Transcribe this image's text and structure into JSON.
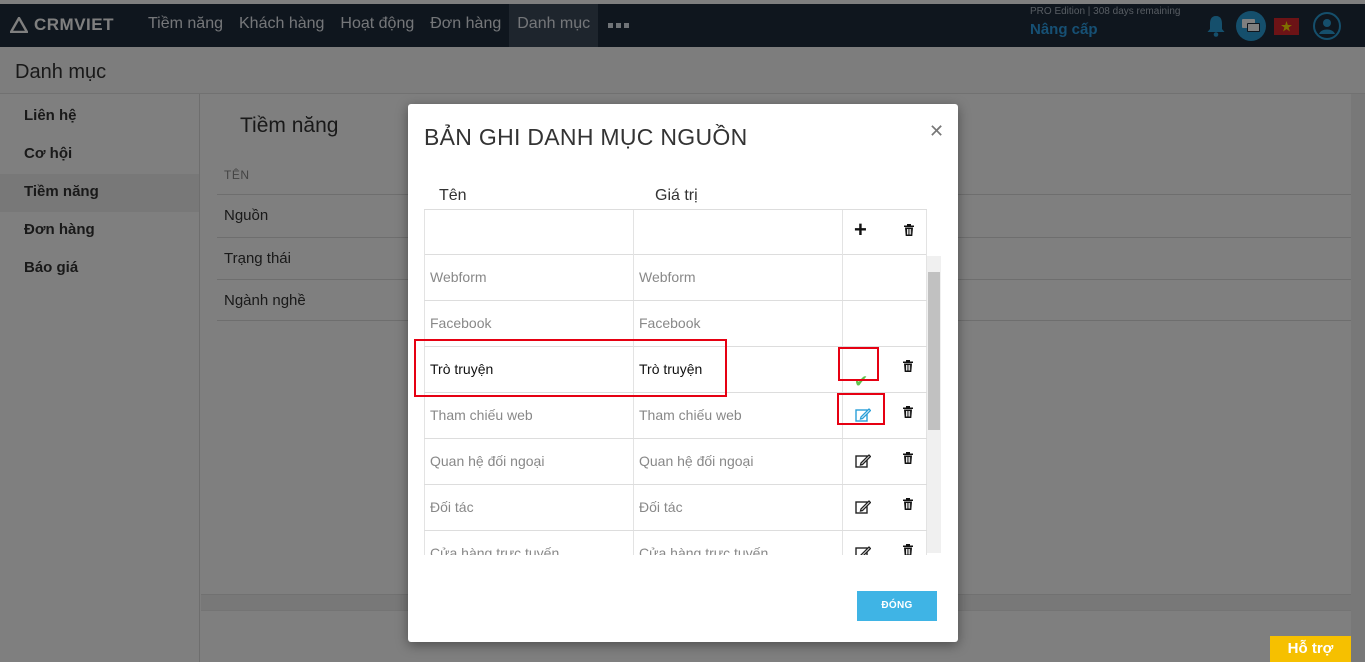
{
  "brand": {
    "name": "CRMVIET"
  },
  "nav": {
    "items": [
      "Tiềm năng",
      "Khách hàng",
      "Hoạt động",
      "Đơn hàng",
      "Danh mục"
    ],
    "active_index": 4
  },
  "edition": "PRO Edition | 308 days remaining",
  "upgrade": "Nâng cấp",
  "page_title": "Danh mục",
  "sidebar": {
    "items": [
      "Liên hệ",
      "Cơ hội",
      "Tiềm năng",
      "Đơn hàng",
      "Báo giá"
    ],
    "active_index": 2
  },
  "main": {
    "title": "Tiềm năng",
    "col_header": "TÊN",
    "rows": [
      "Nguồn",
      "Trạng thái",
      "Ngành nghề"
    ]
  },
  "modal": {
    "title": "BẢN GHI DANH MỤC NGUỒN",
    "col_name": "Tên",
    "col_value": "Giá trị",
    "rows": [
      {
        "name": "Webform",
        "value": "Webform",
        "actions": "none"
      },
      {
        "name": "Facebook",
        "value": "Facebook",
        "actions": "none"
      },
      {
        "name": "Trò truyện",
        "value": "Trò truyện",
        "actions": "save"
      },
      {
        "name": "Tham chiếu web",
        "value": "Tham chiếu web",
        "actions": "edit"
      },
      {
        "name": "Quan hệ đối ngoại",
        "value": "Quan hệ đối ngoại",
        "actions": "edit"
      },
      {
        "name": "Đối tác",
        "value": "Đối tác",
        "actions": "edit"
      },
      {
        "name": "Cửa hàng trực tuyến",
        "value": "Cửa hàng trực tuyến",
        "actions": "edit"
      }
    ],
    "close_label": "ĐÓNG"
  },
  "support": "Hỗ trợ",
  "colors": {
    "navbar": "#1f2d3d",
    "accent": "#3fb4e5",
    "highlight": "#e60012",
    "support": "#f6c000"
  }
}
